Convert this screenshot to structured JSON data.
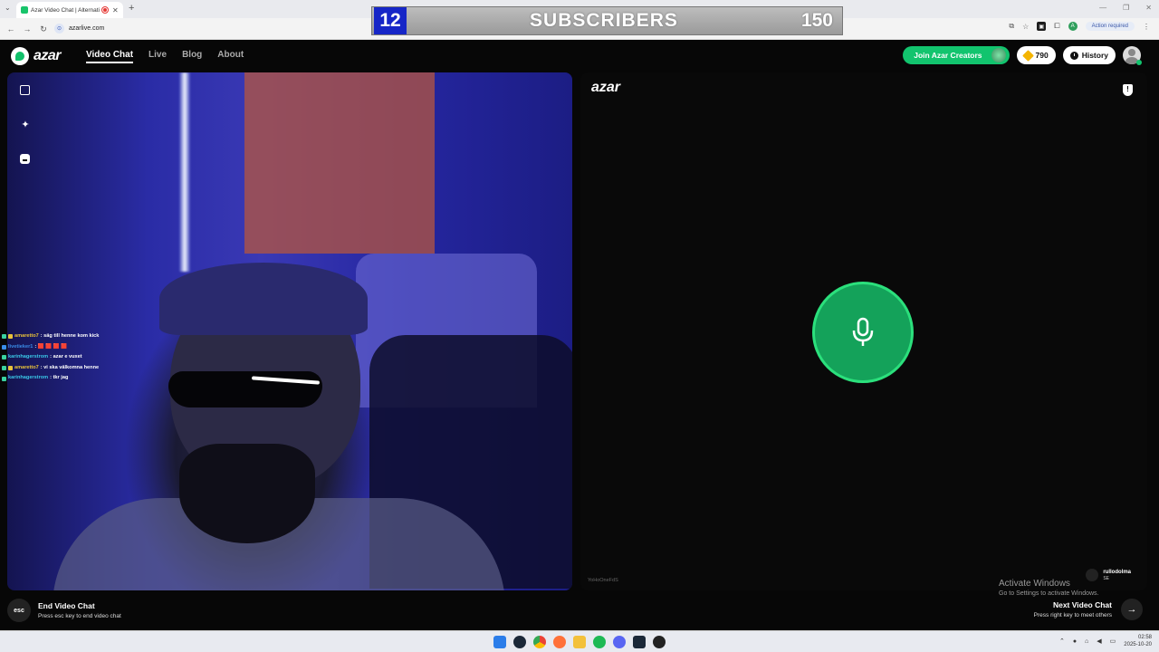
{
  "browser": {
    "tab_title": "Azar Video Chat | Alternati",
    "url": "azarlive.com",
    "action_required": "Action required",
    "profile_initial": "A"
  },
  "overlay": {
    "subscriber_count": "12",
    "label": "SUBSCRIBERS",
    "goal": "150"
  },
  "header": {
    "logo": "azar",
    "nav": [
      "Video Chat",
      "Live",
      "Blog",
      "About"
    ],
    "join_creators": "Join Azar Creators",
    "gems": "790",
    "history": "History"
  },
  "chat": [
    {
      "user": "amaretto7",
      "user_color": "#e8c23a",
      "text": ": säg till henne kom kick"
    },
    {
      "user": "livetieker1",
      "user_color": "#3a8de8",
      "text": ":  🟥 🟥 🟥 🟥"
    },
    {
      "user": "karinhagerstrom",
      "user_color": "#3ac8e8",
      "text": ": azar e vuxet"
    },
    {
      "user": "amaretto7",
      "user_color": "#e8c23a",
      "text": ": vi ska välkomna henne"
    },
    {
      "user": "karinhagerstrom",
      "user_color": "#3ac8e8",
      "text": ": tkr jag"
    }
  ],
  "right_panel": {
    "logo": "azar",
    "user_id": "YoHoOneFdS",
    "partner_name": "rullodolma",
    "partner_country": "SE"
  },
  "footer": {
    "esc_key": "esc",
    "end_title": "End Video Chat",
    "end_sub": "Press esc key to end video chat",
    "next_title": "Next Video Chat",
    "next_sub": "Press right key to meet others"
  },
  "windows": {
    "activate_title": "Activate Windows",
    "activate_sub": "Go to Settings to activate Windows.",
    "time": "02:58",
    "date": "2025-10-20"
  },
  "colors": {
    "brand_green": "#12c46e",
    "mic_green": "#14a25a",
    "overlay_blue": "#1626c7"
  }
}
